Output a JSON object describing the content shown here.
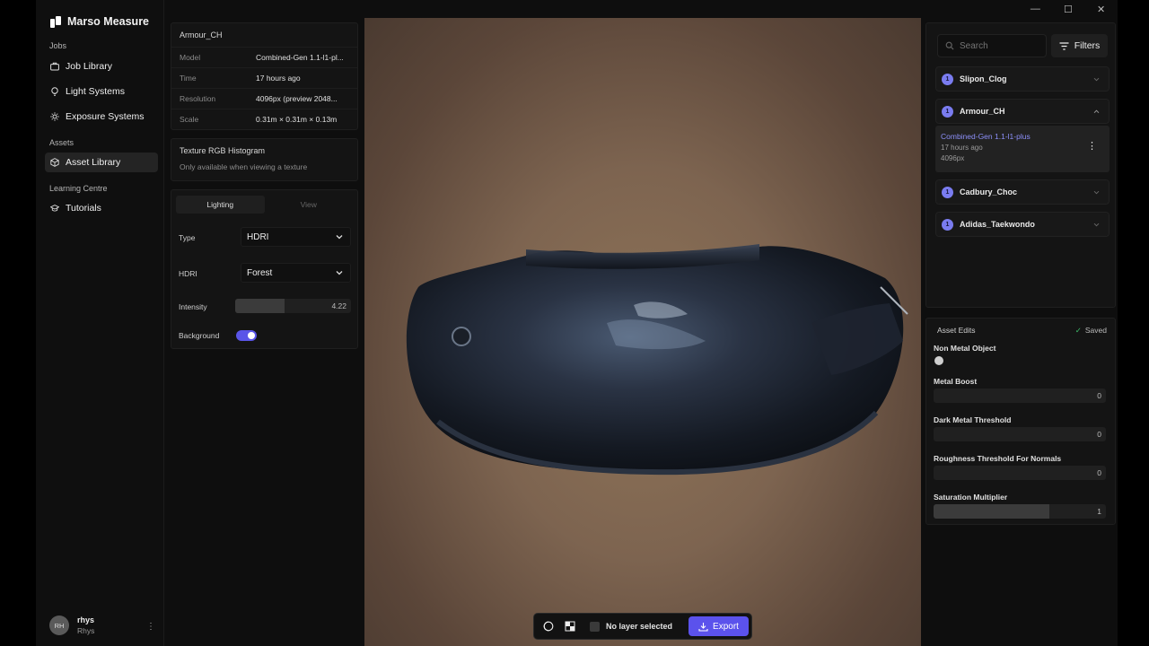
{
  "app": {
    "name": "Marso Measure",
    "window_controls": [
      "—",
      "☐",
      "✕"
    ]
  },
  "sidebar": {
    "sections": {
      "jobs": "Jobs",
      "assets": "Assets",
      "learning": "Learning Centre"
    },
    "items": [
      {
        "label": "Job Library",
        "icon": "briefcase-icon"
      },
      {
        "label": "Light Systems",
        "icon": "bulb-icon"
      },
      {
        "label": "Exposure Systems",
        "icon": "sun-icon"
      },
      {
        "label": "Asset Library",
        "icon": "cube-icon",
        "active": true
      },
      {
        "label": "Tutorials",
        "icon": "graduation-icon"
      }
    ],
    "user": {
      "initials": "RH",
      "name": "rhys",
      "sub": "Rhys"
    }
  },
  "info": {
    "asset_name": "Armour_CH",
    "rows": [
      {
        "k": "Model",
        "v": "Combined-Gen 1.1-l1-pl..."
      },
      {
        "k": "Time",
        "v": "17 hours ago"
      },
      {
        "k": "Resolution",
        "v": "4096px (preview 2048..."
      },
      {
        "k": "Scale",
        "v": "0.31m × 0.31m × 0.13m"
      }
    ]
  },
  "histogram": {
    "title": "Texture RGB Histogram",
    "subtitle": "Only available when viewing a texture"
  },
  "lighting": {
    "tabs": [
      "Lighting",
      "View"
    ],
    "type_label": "Type",
    "type_value": "HDRI",
    "hdri_label": "HDRI",
    "hdri_value": "Forest",
    "intensity_label": "Intensity",
    "intensity_value": "4.22",
    "intensity_fraction": 0.43,
    "background_label": "Background",
    "background_on": true
  },
  "viewport": {
    "layer_status": "No layer selected",
    "export_label": "Export"
  },
  "assets_panel": {
    "search_placeholder": "Search",
    "filters_label": "Filters",
    "items": [
      {
        "count": "1",
        "name": "Slipon_Clog",
        "expanded": false
      },
      {
        "count": "1",
        "name": "Armour_CH",
        "expanded": true
      },
      {
        "count": "1",
        "name": "Cadbury_Choc",
        "expanded": false
      },
      {
        "count": "1",
        "name": "Adidas_Taekwondo",
        "expanded": false
      }
    ],
    "expanded_version": {
      "title": "Combined-Gen 1.1-l1-plus",
      "time": "17 hours ago",
      "resolution": "4096px"
    }
  },
  "asset_edits": {
    "title": "Asset Edits",
    "saved": "Saved",
    "non_metal_label": "Non Metal Object",
    "sliders": [
      {
        "label": "Metal Boost",
        "value": "0",
        "fraction": 0
      },
      {
        "label": "Dark Metal Threshold",
        "value": "0",
        "fraction": 0
      },
      {
        "label": "Roughness Threshold For Normals",
        "value": "0",
        "fraction": 0
      },
      {
        "label": "Saturation Multiplier",
        "value": "1",
        "fraction": 0.67
      }
    ]
  },
  "colors": {
    "accent": "#5b52ec",
    "badge": "#7a7cf0",
    "link": "#8c8ff8",
    "saved": "#3ebd6a"
  }
}
